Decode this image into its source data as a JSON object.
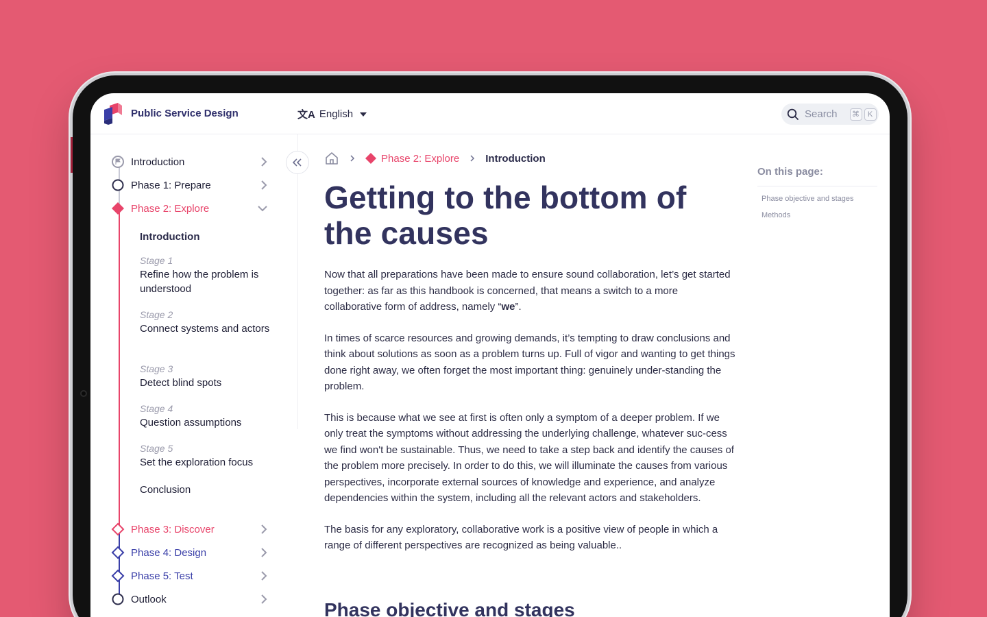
{
  "header": {
    "brand": "Public Service Design",
    "language": "English",
    "search_placeholder": "Search",
    "shortcut_key1": "⌘",
    "shortcut_key2": "K"
  },
  "nav": {
    "phases_before": [
      {
        "label": "Introduction"
      },
      {
        "label": "Phase 1: Prepare"
      },
      {
        "label": "Phase 2: Explore"
      }
    ],
    "subitems": [
      {
        "stage": "",
        "title": "Introduction"
      },
      {
        "stage": "Stage 1",
        "title": "Refine how the problem is understood"
      },
      {
        "stage": "Stage 2",
        "title": "Connect systems and actors"
      },
      {
        "stage": "Stage 3",
        "title": "Detect blind spots"
      },
      {
        "stage": "Stage 4",
        "title": "Question assumptions"
      },
      {
        "stage": "Stage 5",
        "title": "Set the exploration focus"
      },
      {
        "stage": "",
        "title": "Conclusion"
      }
    ],
    "phases_after": [
      {
        "label": "Phase 3: Discover"
      },
      {
        "label": "Phase 4: Design"
      },
      {
        "label": "Phase 5: Test"
      },
      {
        "label": "Outlook"
      }
    ]
  },
  "breadcrumb": {
    "phase": "Phase 2: Explore",
    "current": "Introduction"
  },
  "main": {
    "title": "Getting to the bottom of the causes",
    "p1_a": "Now that all preparations have been made to ensure sound collaboration, let’s get started together: as far as this handbook is concerned, that means a switch to a more collaborative form of address, namely “",
    "p1_bold": "we",
    "p1_b": "”.",
    "p2": "In times of scarce resources and growing demands, it’s tempting to draw conclusions and think about solutions as soon as a problem turns up. Full of vigor and wanting to get things done right away, we often forget the most important thing: genuinely under-standing the problem.",
    "p3": "This is because what we see at first is often only a symptom of a deeper problem. If we only treat the symptoms without addressing the underlying challenge, whatever suc-cess we find won't be sustainable. Thus, we need to take a step back and identify the causes of the problem more precisely. In order to do this, we will illuminate the causes from various perspectives, incorporate external sources of knowledge and experience, and analyze dependencies within the system, including all the relevant actors and stakeholders.",
    "p4": "The basis for any exploratory, collaborative work is a positive view of people in which a range of different perspectives are recognized as being valuable..",
    "h2": "Phase objective and stages"
  },
  "toc": {
    "heading": "On this page:",
    "links": [
      "Phase objective and stages",
      "Methods"
    ]
  },
  "colors": {
    "background": "#e45a72",
    "accent": "#e8446a",
    "heading": "#32335e",
    "phase_upcoming": "#3a3fa8"
  }
}
